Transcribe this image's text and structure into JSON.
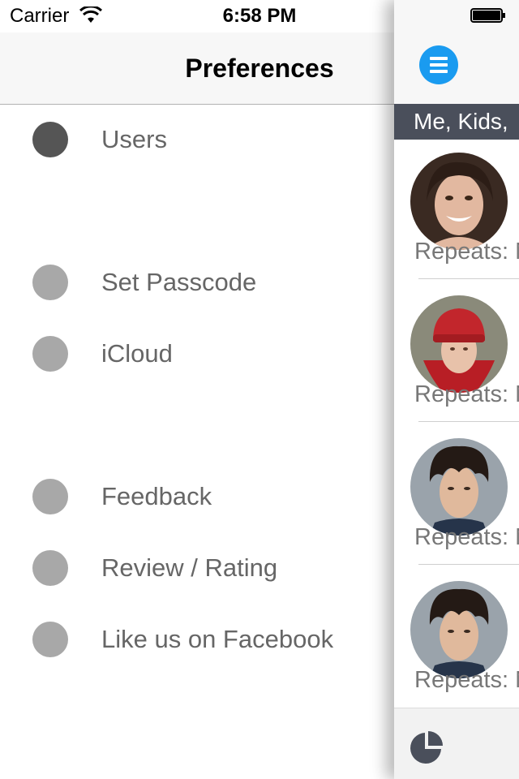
{
  "status_bar": {
    "carrier": "Carrier",
    "time": "6:58 PM"
  },
  "menu": {
    "title": "Preferences",
    "items": [
      {
        "label": "Users",
        "active": true
      },
      {
        "label": "Set Passcode",
        "active": false
      },
      {
        "label": "iCloud",
        "active": false
      },
      {
        "label": "Feedback",
        "active": false
      },
      {
        "label": "Review / Rating",
        "active": false
      },
      {
        "label": "Like us on Facebook",
        "active": false
      }
    ]
  },
  "panel": {
    "section_title": "Me, Kids,",
    "people": [
      {
        "repeat_text": "Repeats: N"
      },
      {
        "repeat_text": "Repeats: N"
      },
      {
        "repeat_text": "Repeats: N"
      },
      {
        "repeat_text": "Repeats: N"
      }
    ]
  },
  "colors": {
    "accent": "#1a9bf0",
    "section_bar": "#4a4f5b",
    "active_dot": "#555555",
    "inactive_dot": "#a8a8a8"
  },
  "icons": {
    "menu_button": "hamburger-icon",
    "tab": "pie-chart-icon",
    "wifi": "wifi-icon",
    "battery": "battery-icon"
  }
}
